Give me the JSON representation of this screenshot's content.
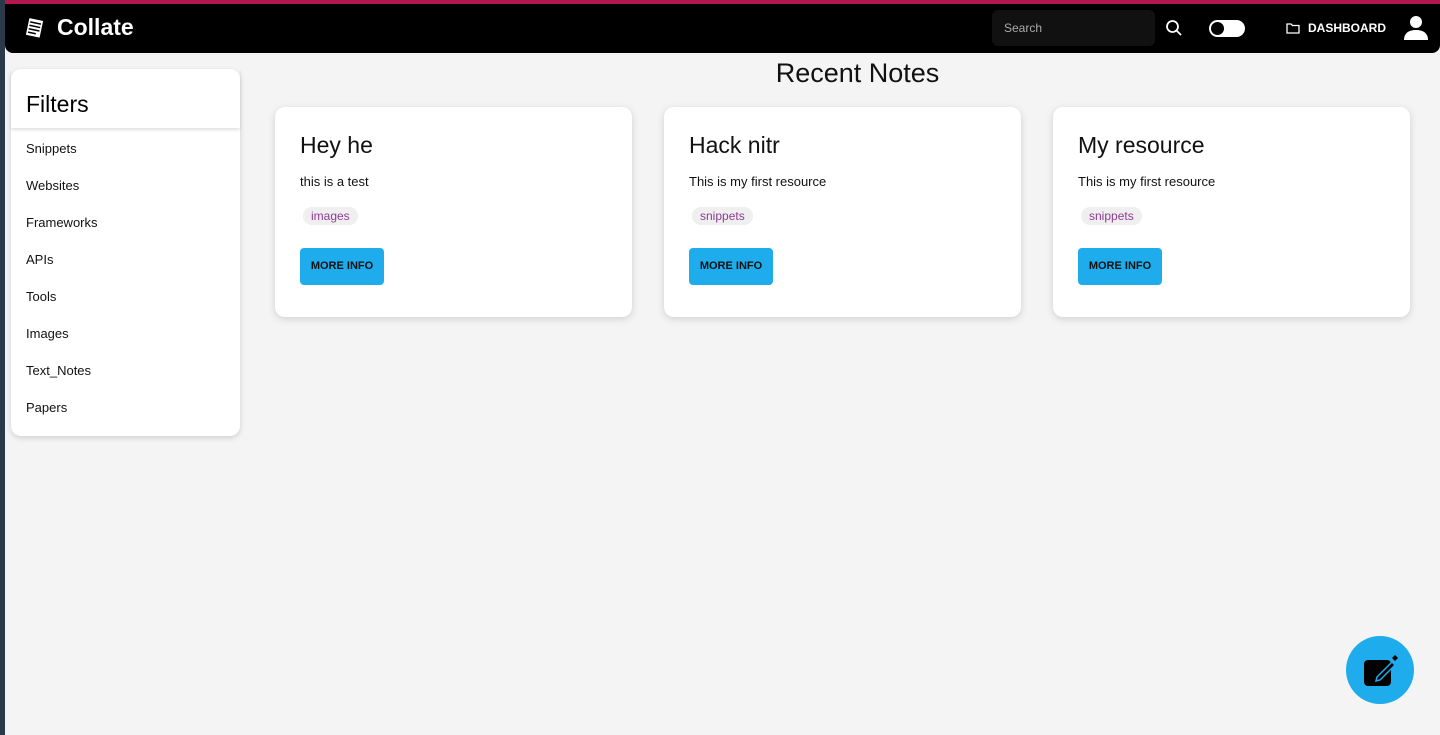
{
  "app": {
    "title": "Collate",
    "accent": "#1eacec",
    "topline": "#b3174f"
  },
  "nav": {
    "search_placeholder": "Search",
    "dashboard_label": "DASHBOARD"
  },
  "filters": {
    "heading": "Filters",
    "items": [
      "Snippets",
      "Websites",
      "Frameworks",
      "APIs",
      "Tools",
      "Images",
      "Text_Notes",
      "Papers"
    ]
  },
  "main": {
    "title": "Recent Notes",
    "cards": [
      {
        "title": "Hey he",
        "body": "this is a test",
        "tag": "images",
        "button": "MORE INFO"
      },
      {
        "title": "Hack nitr",
        "body": "This is my first resource",
        "tag": "snippets",
        "button": "MORE INFO"
      },
      {
        "title": "My resource",
        "body": "This is my first resource",
        "tag": "snippets",
        "button": "MORE INFO"
      }
    ]
  }
}
